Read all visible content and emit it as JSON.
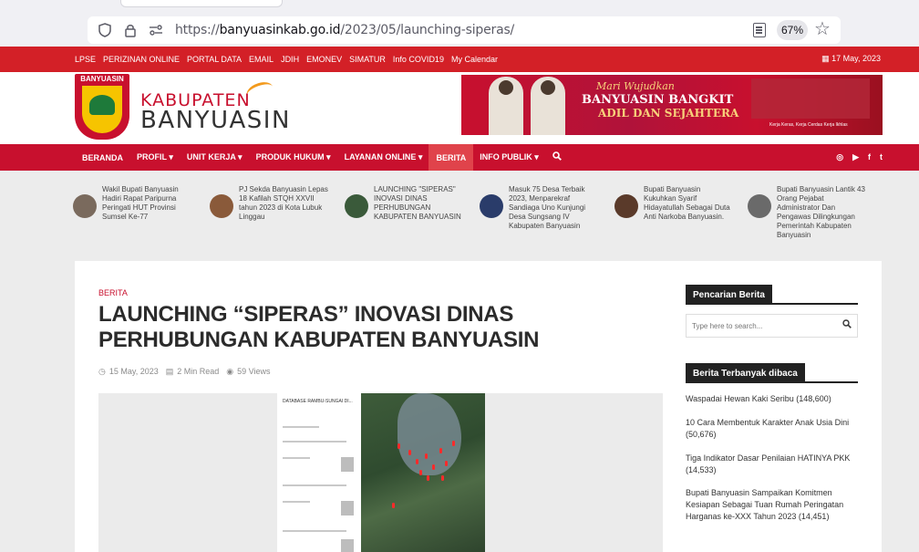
{
  "browser": {
    "url_prefix": "https://",
    "url_host": "banyuasinkab.go.id",
    "url_path": "/2023/05/launching-siperas/",
    "zoom": "67%"
  },
  "topbar": {
    "links": [
      "LPSE",
      "PERIZINAN ONLINE",
      "PORTAL DATA",
      "EMAIL",
      "JDIH",
      "EMONEV",
      "SIMATUR",
      "Info COVID19",
      "My Calendar"
    ],
    "date": "17 May, 2023"
  },
  "header": {
    "logo_text": "BANYUASIN",
    "brand_line1": "KABUPATEN",
    "brand_line2": "BANYUASIN",
    "banner_tagline": "Mari Wujudkan",
    "banner_line1": "BANYUASIN BANGKIT",
    "banner_line2": "ADIL DAN SEJAHTERA",
    "banner_small": "Kerja Keras, Kerja Cerdas Kerja Ikhlas"
  },
  "nav": {
    "items": [
      "BERANDA",
      "PROFIL ▾",
      "UNIT KERJA ▾",
      "PRODUK HUKUM ▾",
      "LAYANAN ONLINE ▾",
      "BERITA",
      "INFO PUBLIK ▾"
    ],
    "active": "BERITA"
  },
  "ticker": [
    "Wakil Bupati Banyuasin Hadiri Rapat Paripurna Peringati HUT Provinsi Sumsel Ke-77",
    "PJ Sekda Banyuasin Lepas 18 Kafilah STQH XXVII tahun 2023 di Kota Lubuk Linggau",
    "LAUNCHING \"SIPERAS\" INOVASI DINAS PERHUBUNGAN KABUPATEN BANYUASIN",
    "Masuk 75 Desa Terbaik 2023, Menparekraf Sandiaga Uno Kunjungi Desa Sungsang IV Kabupaten Banyuasin",
    "Bupati Banyuasin Kukuhkan Syarif Hidayatullah Sebagai Duta Anti Narkoba Banyuasin.",
    "Bupati Banyuasin Lantik 43 Orang Pejabat Administrator Dan Pengawas Dilingkungan Pemerintah Kabupaten Banyuasin"
  ],
  "article": {
    "category": "BERITA",
    "title": "LAUNCHING “SIPERAS” INOVASI DINAS PERHUBUNGAN KABUPATEN BANYUASIN",
    "date": "15 May, 2023",
    "read_time": "2 Min Read",
    "views": "59 Views",
    "phone_header": "DATABASE RAMBU-SUNGAI DI..."
  },
  "sidebar": {
    "search_heading": "Pencarian Berita",
    "search_placeholder": "Type here to search...",
    "popular_heading": "Berita Terbanyak dibaca",
    "popular": [
      "Waspadai Hewan Kaki Seribu (148,600)",
      "10 Cara Membentuk Karakter Anak Usia Dini (50,676)",
      "Tiga Indikator Dasar Penilaian HATINYA PKK (14,533)",
      "Bupati Banyuasin Sampaikan Komitmen Kesiapan Sebagai Tuan Rumah Peringatan Harganas ke-XXX Tahun 2023 (14,451)"
    ]
  }
}
